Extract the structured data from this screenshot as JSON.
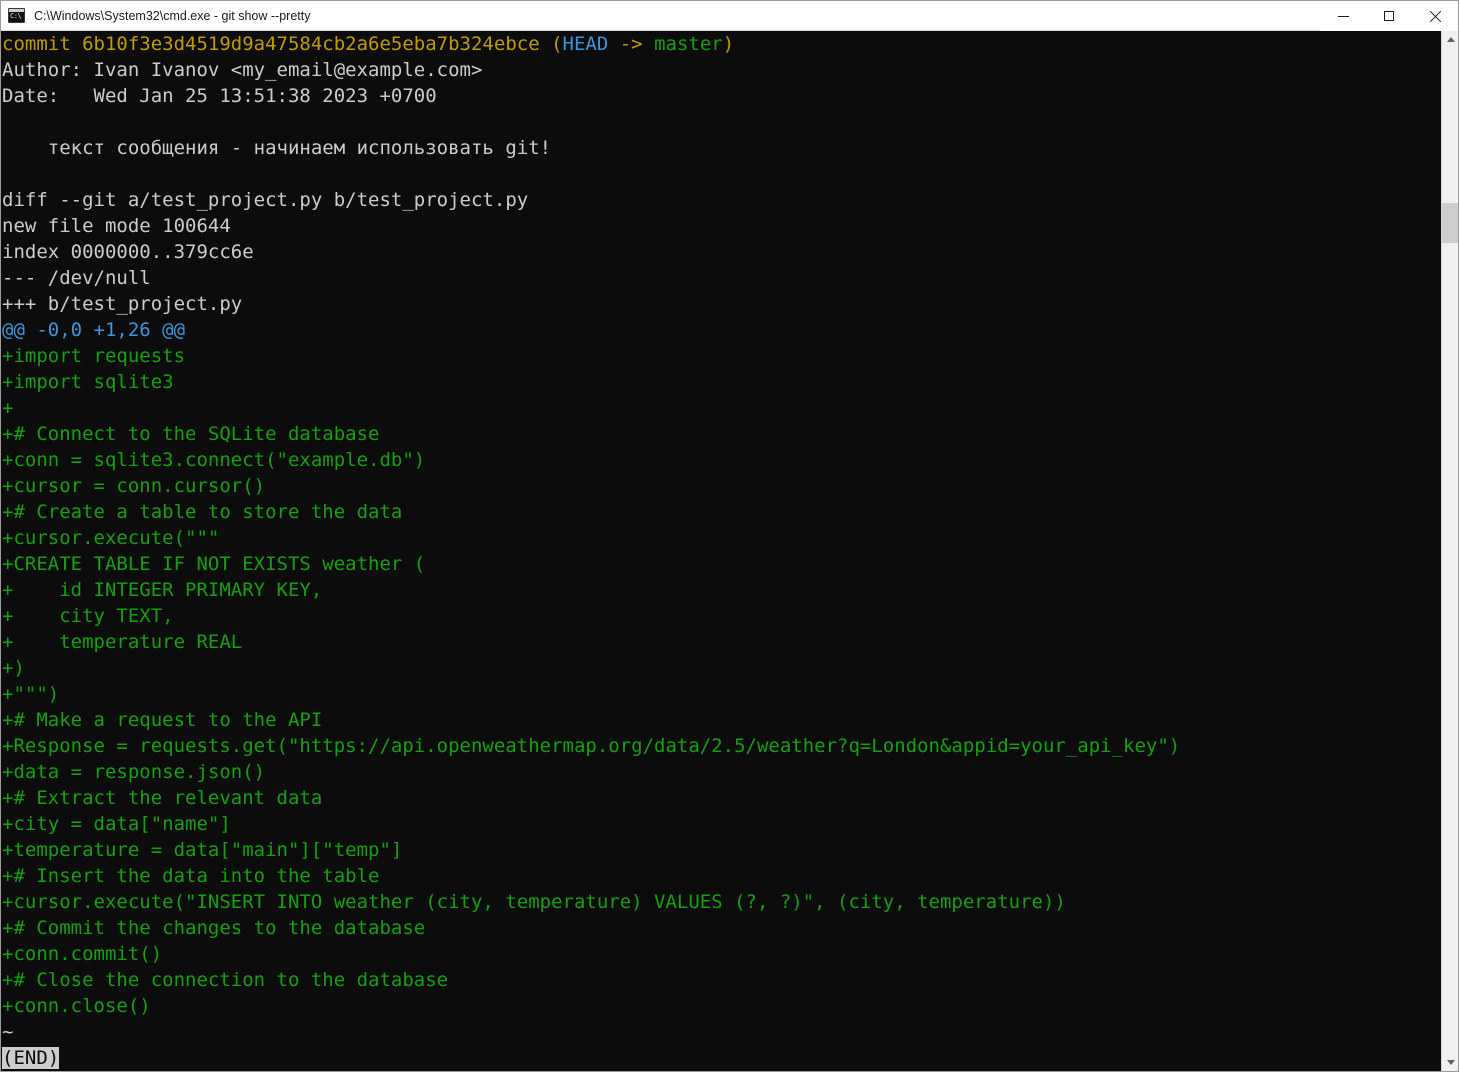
{
  "window": {
    "title": "C:\\Windows\\System32\\cmd.exe - git  show --pretty",
    "icon": "cmd-console-icon",
    "controls": {
      "minimize": "minimize-icon",
      "maximize": "maximize-icon",
      "close": "close-icon"
    },
    "colors": {
      "background": "#0c0c0c",
      "titlebar": "#ffffff",
      "default_text": "#cccccc",
      "yellow": "#c19c00",
      "cyan": "#3a96dd",
      "green": "#13a10e",
      "scrollbar_track": "#f0f0f0",
      "scrollbar_thumb": "#cdcdcd"
    }
  },
  "scrollbar": {
    "up_arrow": "scroll-up-icon",
    "down_arrow": "scroll-down-icon"
  },
  "console": {
    "lines": [
      {
        "type": "commit",
        "segments": [
          {
            "text": "commit 6b10f3e3d4519d9a47584cb2a6e5eba7b324ebce ",
            "color": "yellow"
          },
          {
            "text": "(",
            "color": "yellow"
          },
          {
            "text": "HEAD",
            "color": "cyan"
          },
          {
            "text": " -> ",
            "color": "yellow"
          },
          {
            "text": "master",
            "color": "green"
          },
          {
            "text": ")",
            "color": "yellow"
          }
        ]
      },
      {
        "type": "author",
        "text": "Author: Ivan Ivanov <my_email@example.com>",
        "color": "white"
      },
      {
        "type": "date",
        "text": "Date:   Wed Jan 25 13:51:38 2023 +0700",
        "color": "white"
      },
      {
        "type": "blank",
        "text": "",
        "color": "white"
      },
      {
        "type": "message",
        "text": "    текст сообщения - начинаем использовать git!",
        "color": "white"
      },
      {
        "type": "blank",
        "text": "",
        "color": "white"
      },
      {
        "type": "diff",
        "text": "diff --git a/test_project.py b/test_project.py",
        "color": "white"
      },
      {
        "type": "diff",
        "text": "new file mode 100644",
        "color": "white"
      },
      {
        "type": "diff",
        "text": "index 0000000..379cc6e",
        "color": "white"
      },
      {
        "type": "diff",
        "text": "--- /dev/null",
        "color": "white"
      },
      {
        "type": "diff",
        "text": "+++ b/test_project.py",
        "color": "white"
      },
      {
        "type": "hunk",
        "text": "@@ -0,0 +1,26 @@",
        "color": "hunk"
      },
      {
        "type": "add",
        "text": "+import requests",
        "color": "green"
      },
      {
        "type": "add",
        "text": "+import sqlite3",
        "color": "green"
      },
      {
        "type": "add",
        "text": "+",
        "color": "green"
      },
      {
        "type": "add",
        "text": "+# Connect to the SQLite database",
        "color": "green"
      },
      {
        "type": "add",
        "text": "+conn = sqlite3.connect(\"example.db\")",
        "color": "green"
      },
      {
        "type": "add",
        "text": "+cursor = conn.cursor()",
        "color": "green"
      },
      {
        "type": "add",
        "text": "+# Create a table to store the data",
        "color": "green"
      },
      {
        "type": "add",
        "text": "+cursor.execute(\"\"\"",
        "color": "green"
      },
      {
        "type": "add",
        "text": "+CREATE TABLE IF NOT EXISTS weather (",
        "color": "green"
      },
      {
        "type": "add",
        "text": "+    id INTEGER PRIMARY KEY,",
        "color": "green"
      },
      {
        "type": "add",
        "text": "+    city TEXT,",
        "color": "green"
      },
      {
        "type": "add",
        "text": "+    temperature REAL",
        "color": "green"
      },
      {
        "type": "add",
        "text": "+)",
        "color": "green"
      },
      {
        "type": "add",
        "text": "+\"\"\")",
        "color": "green"
      },
      {
        "type": "add",
        "text": "+# Make a request to the API",
        "color": "green"
      },
      {
        "type": "add",
        "text": "+Response = requests.get(\"https://api.openweathermap.org/data/2.5/weather?q=London&appid=your_api_key\")",
        "color": "green"
      },
      {
        "type": "add",
        "text": "+data = response.json()",
        "color": "green"
      },
      {
        "type": "add",
        "text": "+# Extract the relevant data",
        "color": "green"
      },
      {
        "type": "add",
        "text": "+city = data[\"name\"]",
        "color": "green"
      },
      {
        "type": "add",
        "text": "+temperature = data[\"main\"][\"temp\"]",
        "color": "green"
      },
      {
        "type": "add",
        "text": "+# Insert the data into the table",
        "color": "green"
      },
      {
        "type": "add",
        "text": "+cursor.execute(\"INSERT INTO weather (city, temperature) VALUES (?, ?)\", (city, temperature))",
        "color": "green"
      },
      {
        "type": "add",
        "text": "+# Commit the changes to the database",
        "color": "green"
      },
      {
        "type": "add",
        "text": "+conn.commit()",
        "color": "green"
      },
      {
        "type": "add",
        "text": "+# Close the connection to the database",
        "color": "green"
      },
      {
        "type": "add",
        "text": "+conn.close()",
        "color": "green"
      },
      {
        "type": "tilde",
        "text": "~",
        "color": "white"
      }
    ],
    "pager_prompt": "(END)"
  }
}
